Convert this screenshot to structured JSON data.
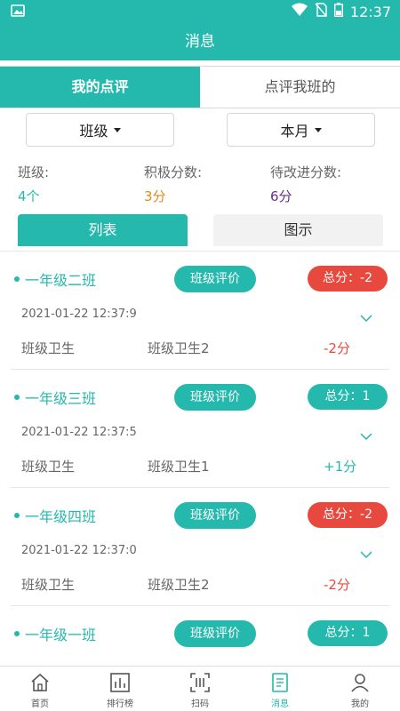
{
  "status_bar": {
    "time": "12:37"
  },
  "app_bar": {
    "title": "消息"
  },
  "tabs": [
    {
      "label": "我的点评",
      "active": true
    },
    {
      "label": "点评我班的",
      "active": false
    }
  ],
  "filters": {
    "class_label": "班级",
    "period_label": "本月"
  },
  "stats": {
    "class": {
      "label": "班级:",
      "value": "4个",
      "color": "#25b9ad"
    },
    "positive": {
      "label": "积极分数:",
      "value": "3分",
      "color": "#e08a1e"
    },
    "improve": {
      "label": "待改进分数:",
      "value": "6分",
      "color": "#6a2c91"
    }
  },
  "view_toggle": {
    "list": "列表",
    "chart": "图示"
  },
  "colors": {
    "accent": "#25b9ad",
    "negative": "#e8493f",
    "positive": "#25b9ad"
  },
  "cards": [
    {
      "name": "一年级二班",
      "eval_label": "班级评价",
      "total": "总分：-2",
      "total_negative": true,
      "time": "2021-01-22 12:37:9",
      "item1": "班级卫生",
      "item2": "班级卫生2",
      "score": "-2分",
      "score_negative": true
    },
    {
      "name": "一年级三班",
      "eval_label": "班级评价",
      "total": "总分：1",
      "total_negative": false,
      "time": "2021-01-22 12:37:5",
      "item1": "班级卫生",
      "item2": "班级卫生1",
      "score": "+1分",
      "score_negative": false
    },
    {
      "name": "一年级四班",
      "eval_label": "班级评价",
      "total": "总分：-2",
      "total_negative": true,
      "time": "2021-01-22 12:37:0",
      "item1": "班级卫生",
      "item2": "班级卫生2",
      "score": "-2分",
      "score_negative": true
    },
    {
      "name": "一年级一班",
      "eval_label": "班级评价",
      "total": "总分：1",
      "total_negative": false,
      "time": "",
      "item1": "",
      "item2": "",
      "score": "",
      "score_negative": false
    }
  ],
  "bottom_nav": [
    {
      "label": "首页",
      "icon": "home-icon",
      "active": false
    },
    {
      "label": "排行榜",
      "icon": "bar-chart-icon",
      "active": false
    },
    {
      "label": "扫码",
      "icon": "scan-icon",
      "active": false
    },
    {
      "label": "消息",
      "icon": "message-icon",
      "active": true
    },
    {
      "label": "我的",
      "icon": "user-icon",
      "active": false
    }
  ]
}
